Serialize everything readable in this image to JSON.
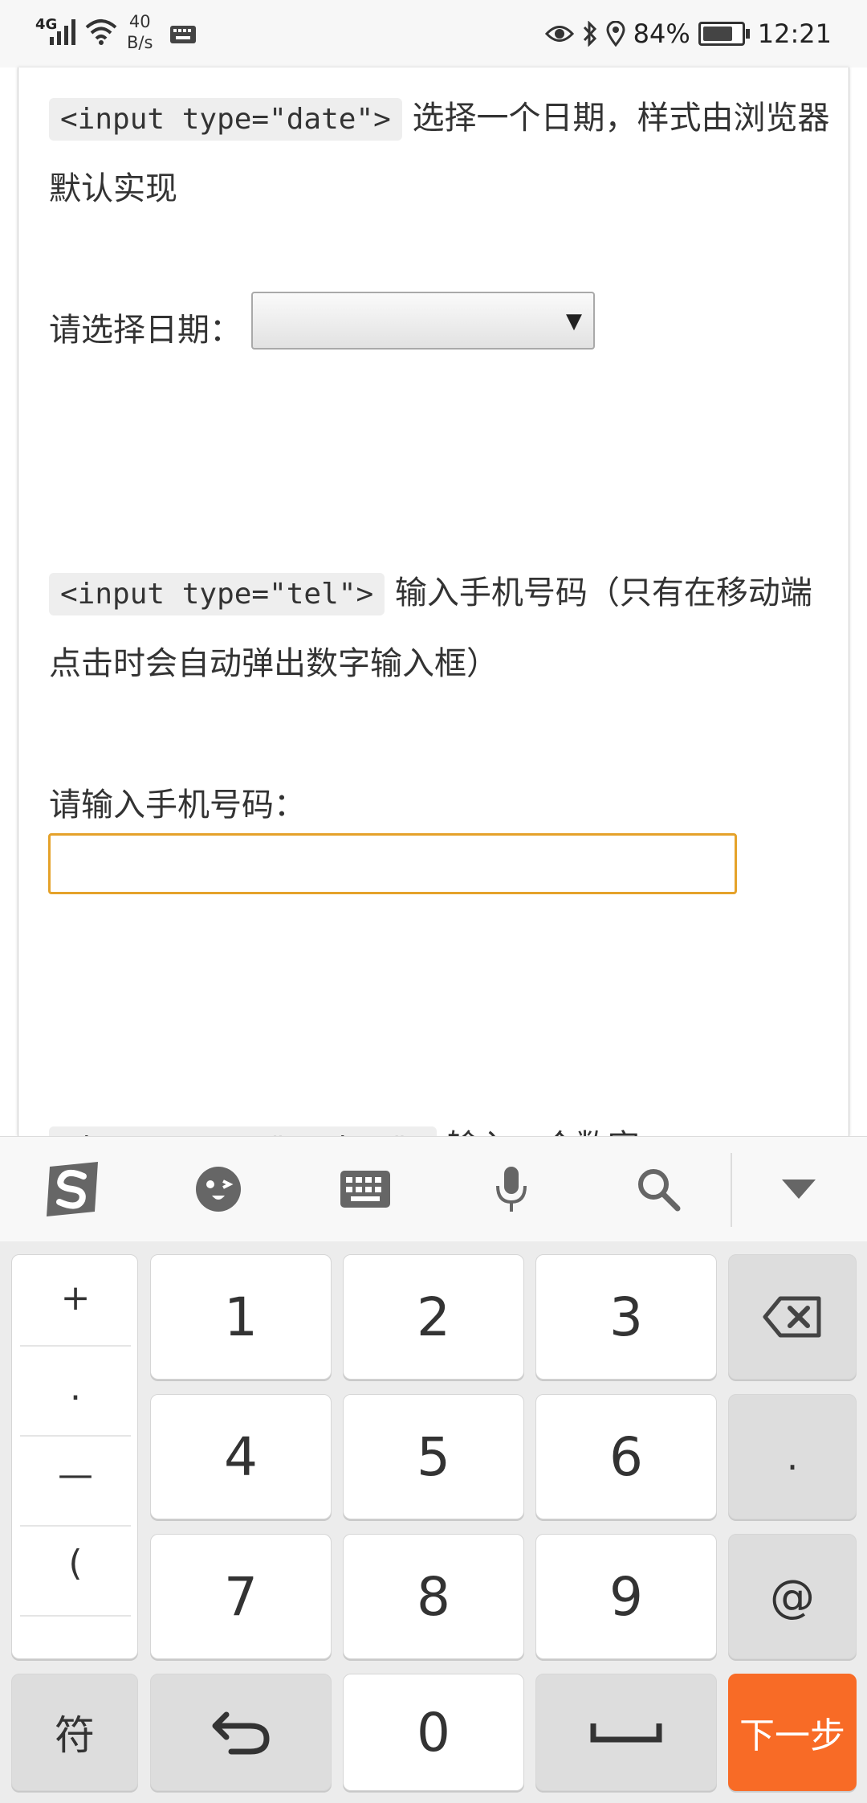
{
  "status_bar": {
    "network": "4G",
    "net_speed_value": "40",
    "net_speed_unit": "B/s",
    "battery": "84%",
    "time": "12:21"
  },
  "page": {
    "date_section": {
      "code": "<input type=\"date\">",
      "description": " 选择一个日期，样式由浏览器默认实现",
      "label": "请选择日期：",
      "select_value": ""
    },
    "tel_section": {
      "code": "<input type=\"tel\">",
      "description": " 输入手机号码（只有在移动端点击时会自动弹出数字输入框）",
      "label": "请输入手机号码：",
      "input_value": ""
    },
    "number_section": {
      "code": "<input type=\"number\">",
      "description": " 输入一个数字"
    }
  },
  "keyboard": {
    "toolbar_icons": [
      "sogou-logo-icon",
      "emoji-icon",
      "keyboard-icon",
      "microphone-icon",
      "search-icon",
      "collapse-icon"
    ],
    "symbols": [
      "+",
      ".",
      "—",
      "("
    ],
    "digits": [
      "1",
      "2",
      "3",
      "4",
      "5",
      "6",
      "7",
      "8",
      "9",
      "0"
    ],
    "dot_key": ".",
    "at_key": "@",
    "symbol_key": "符",
    "next_key": "下一步",
    "accent_color": "#f86b26"
  }
}
